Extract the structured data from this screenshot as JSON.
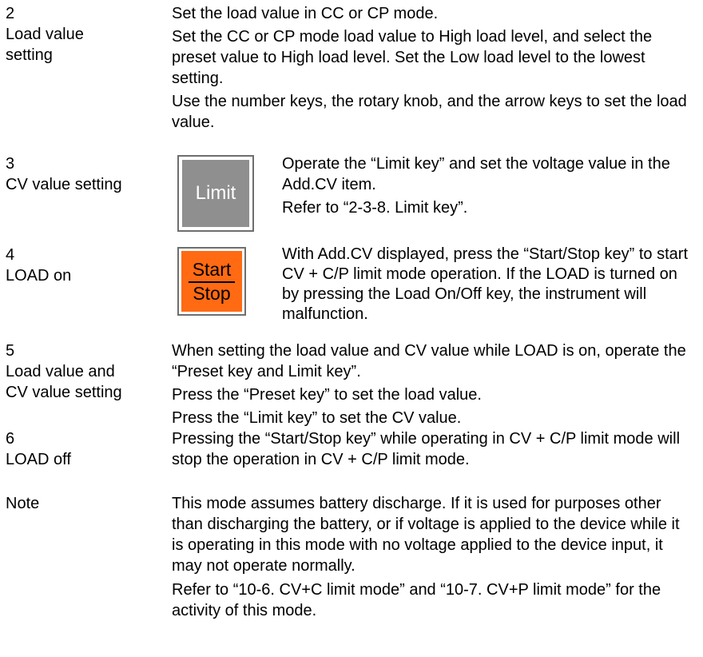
{
  "steps": [
    {
      "number": "2",
      "title_lines": [
        "Load value",
        "setting"
      ],
      "paragraphs": [
        "Set the load value in CC or CP mode.",
        "Set the CC or CP mode load value to High load level, and select the preset value to High load level. Set the Low load level to the lowest setting.",
        "Use the number keys, the rotary knob, and the arrow keys to set the load value."
      ]
    },
    {
      "number": "3",
      "title_lines": [
        "CV value setting"
      ],
      "key_label": "Limit",
      "paragraphs": [
        "Operate the “Limit key” and set the voltage value in the Add.CV item.",
        "Refer to “2-3-8. Limit key”."
      ]
    },
    {
      "number": "4",
      "title_lines": [
        "LOAD on"
      ],
      "key_top": "Start",
      "key_bottom": "Stop",
      "paragraphs": [
        "With Add.CV displayed, press the “Start/Stop key” to start CV + C/P limit mode operation. If the LOAD is turned on by pressing the Load On/Off key, the instrument will malfunction."
      ]
    },
    {
      "number": "5",
      "title_lines": [
        "Load value and",
        "CV value setting"
      ],
      "paragraphs": [
        "When setting the load value and CV value while LOAD is on, operate the “Preset key and Limit key”.",
        "Press the “Preset key” to set the load value.",
        "Press the “Limit key” to set the CV value."
      ]
    },
    {
      "number": "6",
      "title_lines": [
        "LOAD off"
      ],
      "paragraphs": [
        "Pressing the “Start/Stop key” while operating in CV + C/P limit mode will stop the operation in CV + C/P limit mode."
      ]
    }
  ],
  "note": {
    "label": "Note",
    "paragraphs": [
      "This mode assumes battery discharge. If it is used for purposes other than discharging the battery, or if voltage is applied to the device while it is operating in this mode with no voltage applied to the device input, it may not operate normally.",
      "Refer to “10-6. CV+C limit mode” and “10-7. CV+P limit mode” for the activity of this mode."
    ]
  },
  "colors": {
    "limit_key_bg": "#8f8f8f",
    "start_key_bg": "#ff6a13"
  }
}
